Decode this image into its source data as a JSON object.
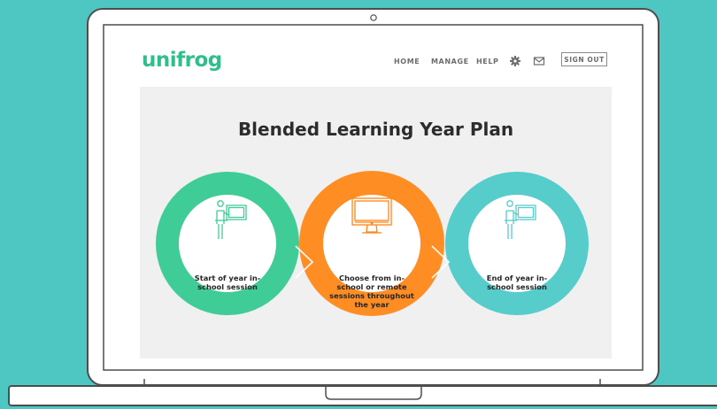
{
  "brand": {
    "logo_text": "unifrog"
  },
  "nav": {
    "home": "HOME",
    "manage": "MANAGE",
    "help": "HELP",
    "settings_icon": "gear-icon",
    "messages_icon": "mail-icon",
    "sign_out": "SIGN OUT"
  },
  "plan": {
    "title": "Blended Learning Year Plan",
    "steps": [
      {
        "label": "Start of year in-school session",
        "icon": "teacher-whiteboard-icon",
        "color": "#3fcc97"
      },
      {
        "label": "Choose from in-school or remote sessions throughout the year",
        "icon": "computer-monitor-icon",
        "color": "#ff8614"
      },
      {
        "label": "End of year in-school session",
        "icon": "teacher-whiteboard-icon",
        "color": "#56cccb"
      }
    ]
  },
  "colors": {
    "background": "#4ec7c2",
    "brand_green": "#2fbf8a",
    "panel": "#f0f0f0"
  }
}
